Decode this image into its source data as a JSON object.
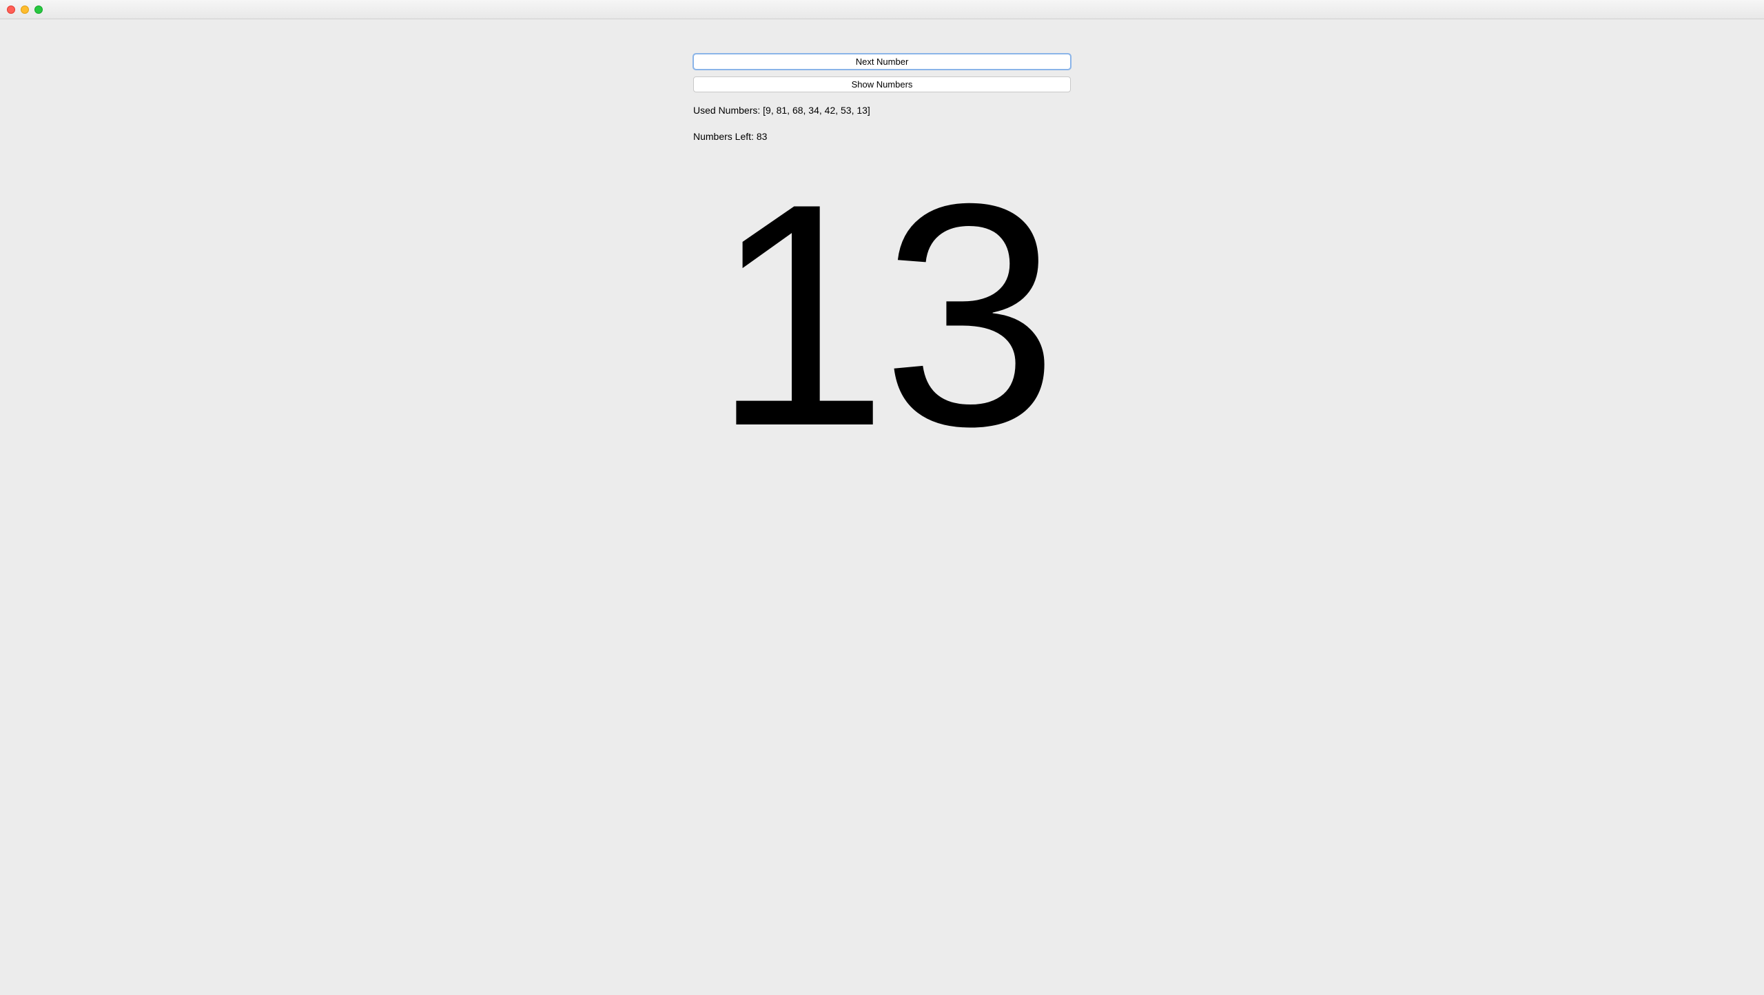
{
  "buttons": {
    "next_number": "Next Number",
    "show_numbers": "Show Numbers"
  },
  "used_numbers_label": "Used Numbers: [9, 81, 68, 34, 42, 53, 13]",
  "numbers_left_label": "Numbers Left: 83",
  "current_number": "13"
}
